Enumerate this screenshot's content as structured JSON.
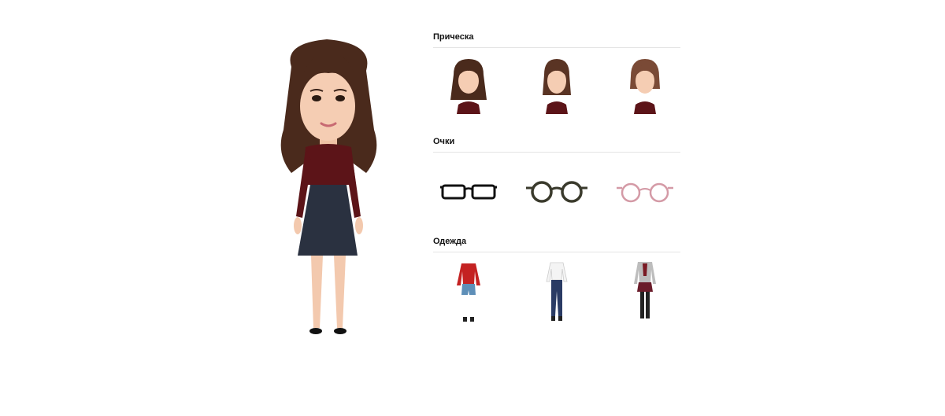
{
  "avatar": {
    "icon": "avatar-figure-icon"
  },
  "sections": {
    "hairstyle": {
      "title": "Прическа",
      "options": [
        {
          "icon": "hairstyle-long-wavy-icon"
        },
        {
          "icon": "hairstyle-shoulder-length-icon"
        },
        {
          "icon": "hairstyle-bob-icon"
        }
      ]
    },
    "glasses": {
      "title": "Очки",
      "options": [
        {
          "icon": "glasses-rectangular-black-icon"
        },
        {
          "icon": "glasses-round-dark-icon"
        },
        {
          "icon": "glasses-round-pink-icon"
        }
      ]
    },
    "clothing": {
      "title": "Одежда",
      "options": [
        {
          "icon": "outfit-red-sweater-shorts-icon"
        },
        {
          "icon": "outfit-white-blouse-jeans-icon"
        },
        {
          "icon": "outfit-cardigan-skirt-icon"
        }
      ]
    }
  },
  "colors": {
    "hair": "#4a2a1c",
    "skin": "#f3c9ae",
    "top": "#5c1418",
    "skirt": "#2a3140",
    "glasses_black": "#111111",
    "glasses_dark": "#3a3a2c",
    "glasses_pink": "#d49aa6",
    "divider": "#e4e4e4"
  }
}
